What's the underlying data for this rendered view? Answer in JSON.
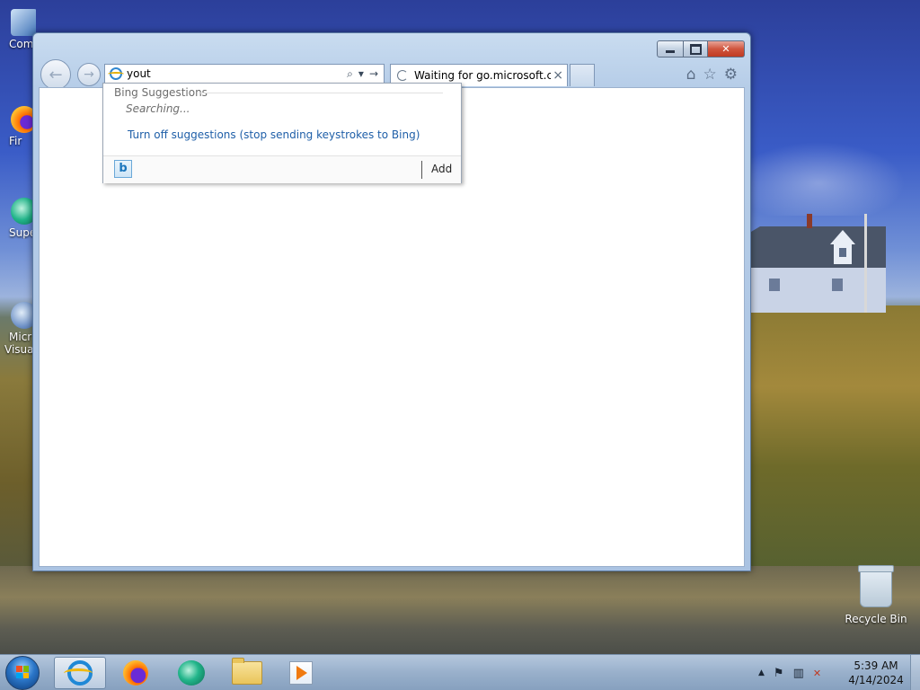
{
  "desktop": {
    "icons": [
      {
        "label": "Com"
      },
      {
        "label": "Fir"
      },
      {
        "label": "Supe"
      },
      {
        "label": "Micr"
      },
      {
        "label": "Visual"
      }
    ],
    "recycle_bin": "Recycle Bin"
  },
  "browser": {
    "address_value": "yout",
    "tab_title": "Waiting for go.microsoft.c...",
    "tab_close": "×",
    "toolbar_glyphs": {
      "home": "⌂",
      "favorites": "☆",
      "settings": "⚙"
    },
    "nav": {
      "back": "←",
      "forward": "→"
    },
    "addr_tools": {
      "search": "⌕",
      "dropdown": "▾",
      "go": "→"
    }
  },
  "suggestions": {
    "header": "Bing Suggestions",
    "status": "Searching...",
    "turn_off_link": "Turn off suggestions (stop sending keystrokes to Bing)",
    "provider_glyph": "b",
    "add_label": "Add"
  },
  "taskbar": {
    "time": "5:39 AM",
    "date": "4/14/2024",
    "tray_glyphs": {
      "show_hidden": "▲",
      "flag": "⚑",
      "network": "▥",
      "volume": "✕"
    }
  },
  "colors": {
    "link_blue": "#1f5fa8",
    "close_red": "#c03a22"
  }
}
